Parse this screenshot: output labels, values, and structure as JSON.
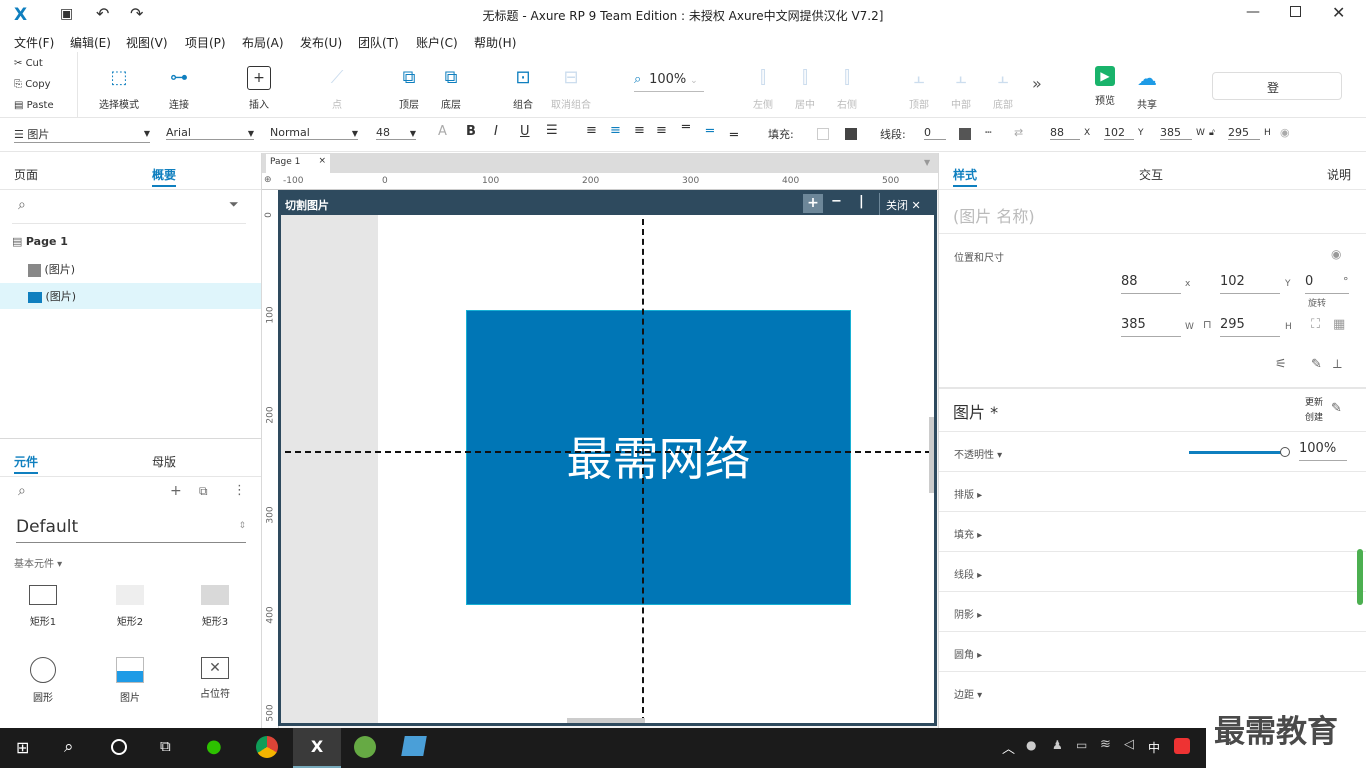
{
  "app": {
    "title": "无标题 - Axure RP 9 Team Edition : 未授权    Axure中文网提供汉化 V7.2]"
  },
  "menu": [
    "文件(F)",
    "编辑(E)",
    "视图(V)",
    "项目(P)",
    "布局(A)",
    "发布(U)",
    "团队(T)",
    "账户(C)",
    "帮助(H)"
  ],
  "clipboard": {
    "cut": "Cut",
    "copy": "Copy",
    "paste": "Paste"
  },
  "toolbar": {
    "select_mode": "选择模式",
    "connect": "连接",
    "insert": "插入",
    "point": "点",
    "top_layer": "顶层",
    "bottom_layer": "底层",
    "group": "组合",
    "ungroup": "取消组合",
    "zoom": "100%",
    "align_left": "左侧",
    "align_center": "居中",
    "align_right": "右侧",
    "align_top": "顶部",
    "align_middle": "中部",
    "align_bottom": "底部",
    "preview": "预览",
    "share": "共享",
    "login": "登"
  },
  "format": {
    "type": "图片",
    "font": "Arial",
    "weight": "Normal",
    "size": "48",
    "fill_label": "填充:",
    "stroke_label": "线段:",
    "stroke_value": "0",
    "x": "88",
    "x_label": "X",
    "y": "102",
    "y_label": "Y",
    "w": "385",
    "w_label": "W",
    "h": "295",
    "h_label": "H"
  },
  "left": {
    "tab_pages": "页面",
    "tab_outline": "概要",
    "page_name": "Page 1",
    "outline_items": [
      "(图片)",
      "(图片)"
    ],
    "tab_widgets": "元件",
    "tab_masters": "母版",
    "library": "Default",
    "section": "基本元件 ▾",
    "widgets": [
      "矩形1",
      "矩形2",
      "矩形3",
      "圆形",
      "图片",
      "占位符"
    ]
  },
  "canvas": {
    "tab": "Page 1",
    "ruler_h": [
      "-100",
      "0",
      "100",
      "200",
      "300",
      "400",
      "500"
    ],
    "ruler_v": [
      "0",
      "100",
      "200",
      "300",
      "400",
      "500"
    ],
    "dialog_title": "切割图片",
    "close_label": "关闭",
    "image_text": "最需网络",
    "image_color": "#0076b6"
  },
  "right": {
    "tab_style": "样式",
    "tab_interact": "交互",
    "tab_notes": "说明",
    "name_placeholder": "(图片 名称)",
    "pos_size": "位置和尺寸",
    "x": "88",
    "x_label": "x",
    "y": "102",
    "y_label": "Y",
    "rotate": "0",
    "rotate_unit": "°",
    "rotate_label": "旋转",
    "w": "385",
    "w_label": "W",
    "h": "295",
    "h_label": "H",
    "style_name": "图片 *",
    "update": "更新",
    "create": "创建",
    "opacity_label": "不透明性 ▾",
    "opacity_value": "100%",
    "opacity": 1.0,
    "sections": [
      "排版 ▸",
      "填充 ▸",
      "线段 ▸",
      "阴影 ▸",
      "圆角 ▸",
      "边距 ▾"
    ]
  },
  "taskbar": {
    "ime": "中",
    "watermark": "最需教育"
  },
  "colors": {
    "accent": "#0f7fbf",
    "dialog_bar": "#2e4a5e",
    "taskbar": "#1b1b1b"
  }
}
